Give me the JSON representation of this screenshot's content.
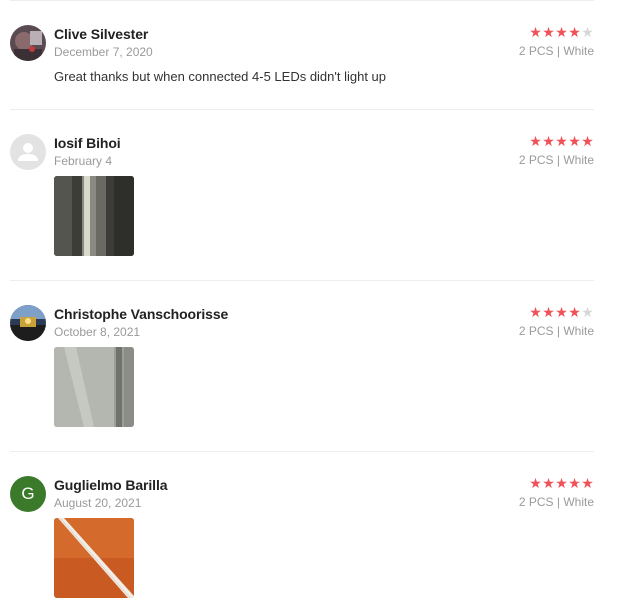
{
  "reviews": [
    {
      "name": "Clive Silvester",
      "date": "December 7, 2020",
      "rating": 4,
      "variant": "2 PCS | White",
      "comment": "Great thanks but when connected 4-5 LEDs didn't light up",
      "avatar_type": "photo"
    },
    {
      "name": "Iosif Bihoi",
      "date": "February 4",
      "rating": 5,
      "variant": "2 PCS | White",
      "avatar_type": "default-user-icon"
    },
    {
      "name": "Christophe Vanschoorisse",
      "date": "October 8, 2021",
      "rating": 4,
      "variant": "2 PCS | White",
      "avatar_type": "photo"
    },
    {
      "name": "Guglielmo Barilla",
      "date": "August 20, 2021",
      "rating": 5,
      "variant": "2 PCS | White",
      "avatar_type": "letter",
      "avatar_letter": "G",
      "avatar_color": "#3a7a2a"
    }
  ],
  "colors": {
    "star_on": "#f05057",
    "star_off": "#d6d6d6"
  }
}
